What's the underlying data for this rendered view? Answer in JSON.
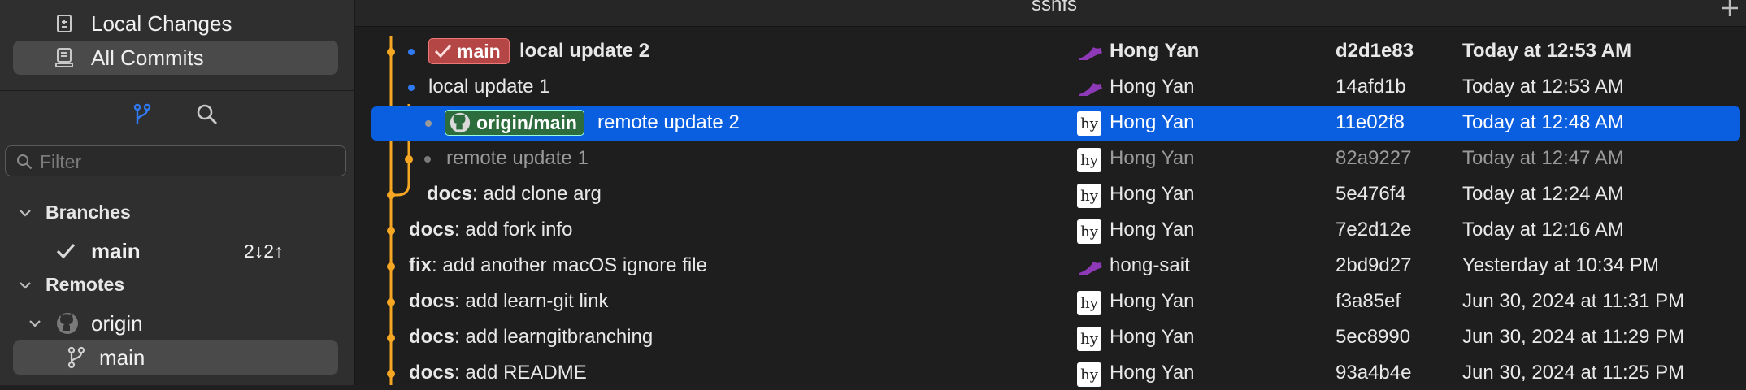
{
  "sidebar": {
    "nav": [
      {
        "label": "Local Changes",
        "icon": "local-changes-icon",
        "selected": false
      },
      {
        "label": "All Commits",
        "icon": "all-commits-icon",
        "selected": true
      }
    ],
    "filter_placeholder": "Filter",
    "branches_header": "Branches",
    "branch": {
      "name": "main",
      "status": "2↓2↑"
    },
    "remotes_header": "Remotes",
    "remote": {
      "name": "origin",
      "branch": "main"
    }
  },
  "window": {
    "title": "sshfs"
  },
  "commits": [
    {
      "ref": "main",
      "message": "local update 2",
      "author": "Hong Yan",
      "hash": "d2d1e83",
      "date": "Today at 12:53 AM",
      "bold": true,
      "avatar": "shoe"
    },
    {
      "message": "local update 1",
      "author": "Hong Yan",
      "hash": "14afd1b",
      "date": "Today at 12:53 AM",
      "avatar": "shoe"
    },
    {
      "ref": "origin/main",
      "message": "remote update 2",
      "author": "Hong Yan",
      "hash": "11e02f8",
      "date": "Today at 12:48 AM",
      "selected": true,
      "avatar": "hy"
    },
    {
      "message": "remote update 1",
      "author": "Hong Yan",
      "hash": "82a9227",
      "date": "Today at 12:47 AM",
      "dim": true,
      "avatar": "hy"
    },
    {
      "prefix": "docs",
      "message": ": add clone arg",
      "author": "Hong Yan",
      "hash": "5e476f4",
      "date": "Today at 12:24 AM",
      "avatar": "hy"
    },
    {
      "prefix": "docs",
      "message": ": add fork info",
      "author": "Hong Yan",
      "hash": "7e2d12e",
      "date": "Today at 12:16 AM",
      "avatar": "hy"
    },
    {
      "prefix": "fix",
      "message": ": add another macOS ignore file",
      "author": "hong-sait",
      "hash": "2bd9d27",
      "date": "Yesterday at 10:34 PM",
      "avatar": "shoe"
    },
    {
      "prefix": "docs",
      "message": ": add learn-git link",
      "author": "Hong Yan",
      "hash": "f3a85ef",
      "date": "Jun 30, 2024 at 11:31 PM",
      "avatar": "hy"
    },
    {
      "prefix": "docs",
      "message": ": add learngitbranching",
      "author": "Hong Yan",
      "hash": "5ec8990",
      "date": "Jun 30, 2024 at 11:29 PM",
      "avatar": "hy"
    },
    {
      "prefix": "docs",
      "message": ": add README",
      "author": "Hong Yan",
      "hash": "93a4b4e",
      "date": "Jun 30, 2024 at 11:25 PM",
      "avatar": "hy"
    }
  ],
  "colors": {
    "graph": "#f5a623",
    "selection": "#0a5ee0",
    "local_dot": "#2f7bf5"
  },
  "avatar_text": "hy"
}
